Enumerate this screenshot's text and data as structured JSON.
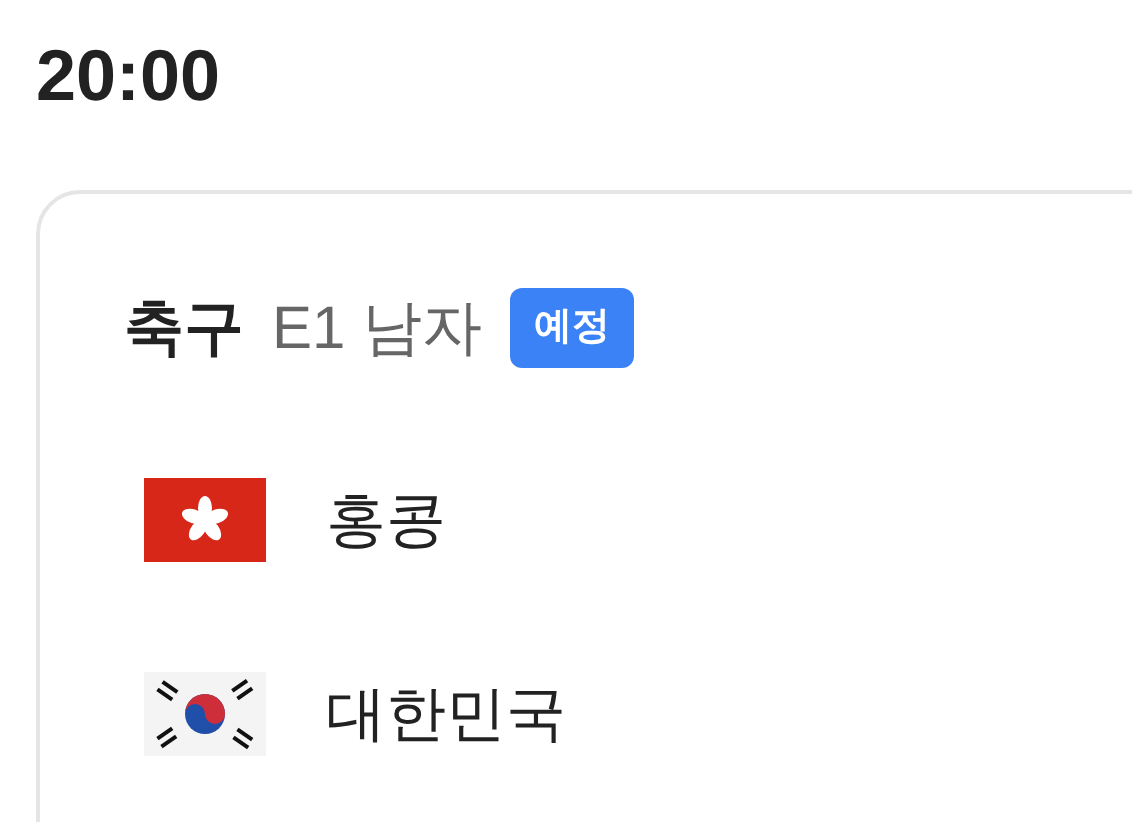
{
  "time": "20:00",
  "match": {
    "sport": "축구",
    "event": "E1 남자",
    "status": {
      "label": "예정",
      "kind": "scheduled"
    },
    "teams": [
      {
        "name": "홍콩",
        "kind": "hong-kong"
      },
      {
        "name": "대한민국",
        "kind": "south-korea"
      }
    ]
  }
}
